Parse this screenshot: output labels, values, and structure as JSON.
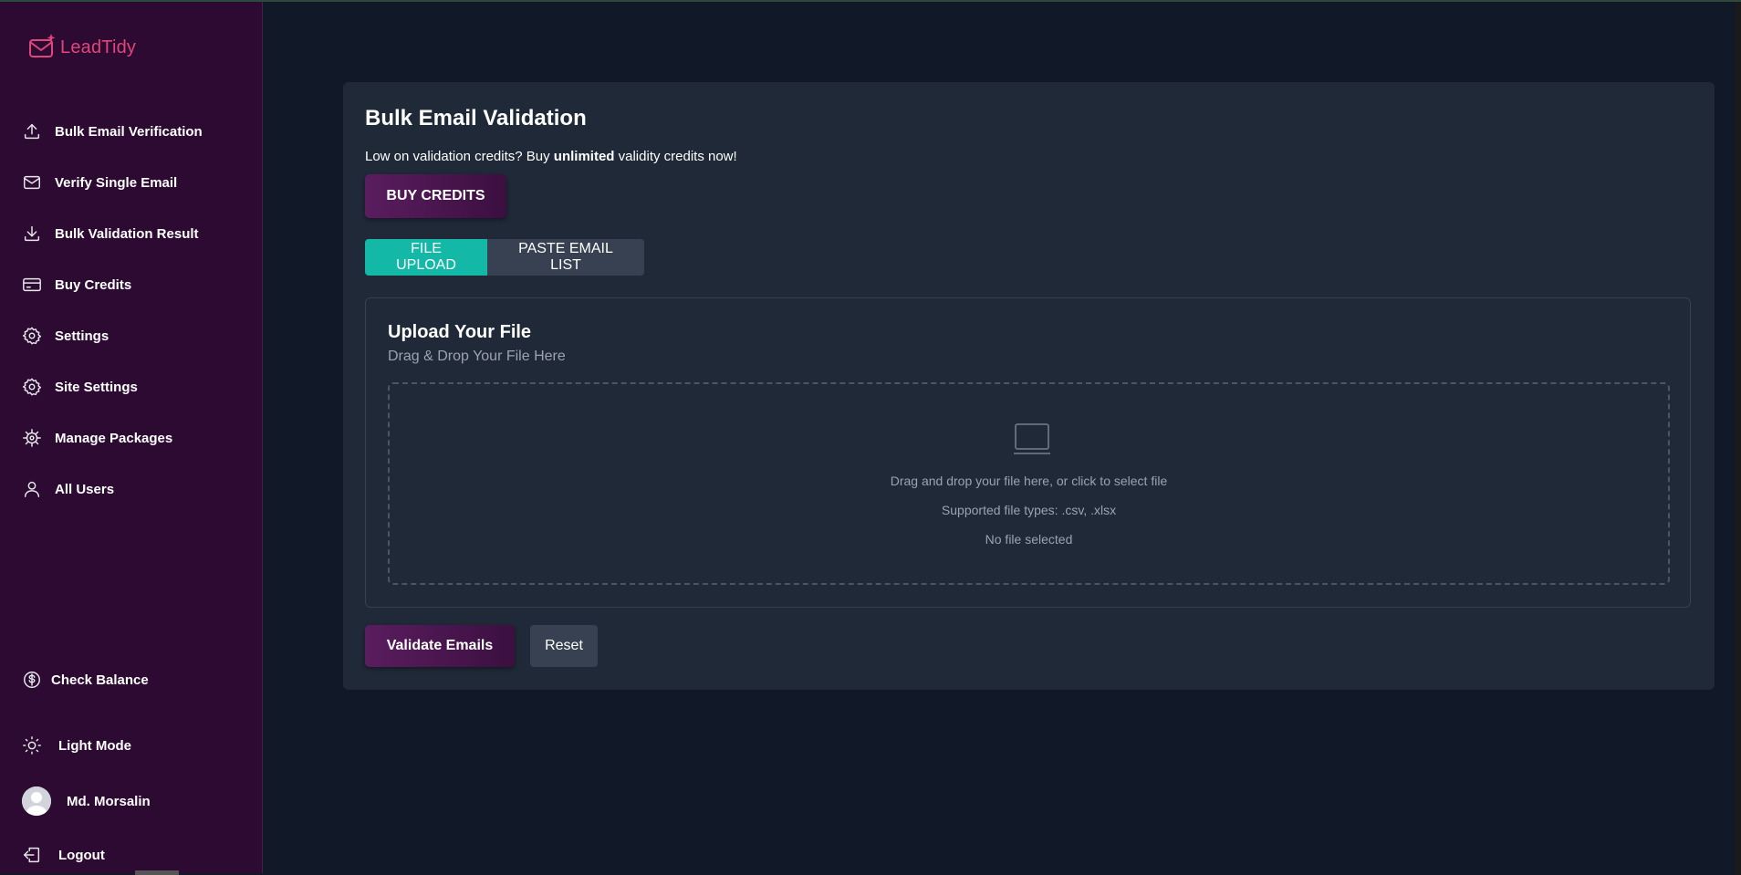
{
  "brand": {
    "name": "LeadTidy",
    "color": "#e0457b"
  },
  "sidebar": {
    "items": [
      {
        "label": "Bulk Email Verification",
        "icon": "upload-icon"
      },
      {
        "label": "Verify Single Email",
        "icon": "mail-icon"
      },
      {
        "label": "Bulk Validation Result",
        "icon": "download-icon"
      },
      {
        "label": "Buy Credits",
        "icon": "credit-card-icon"
      },
      {
        "label": "Settings",
        "icon": "gear-icon"
      },
      {
        "label": "Site Settings",
        "icon": "gear-icon"
      },
      {
        "label": "Manage Packages",
        "icon": "cog-icon"
      },
      {
        "label": "All Users",
        "icon": "user-icon"
      }
    ],
    "bottom": {
      "check_balance": "Check Balance",
      "light_mode": "Light Mode",
      "user_name": "Md. Morsalin",
      "logout": "Logout"
    }
  },
  "main": {
    "title": "Bulk Email Validation",
    "promo_prefix": "Low on validation credits? Buy ",
    "promo_bold": "unlimited",
    "promo_suffix": " validity credits now!",
    "buy_credits_label": "BUY CREDITS",
    "tabs": [
      {
        "label": "FILE UPLOAD",
        "active": true
      },
      {
        "label": "PASTE EMAIL LIST",
        "active": false
      }
    ],
    "upload": {
      "title": "Upload Your File",
      "subtitle": "Drag & Drop Your File Here",
      "drop_text": "Drag and drop your file here, or click to select file",
      "supported": "Supported file types: .csv, .xlsx",
      "status": "No file selected"
    },
    "validate_label": "Validate Emails",
    "reset_label": "Reset"
  },
  "colors": {
    "sidebar_bg": "#2c0a32",
    "page_bg": "#111827",
    "card_bg": "#1f2937",
    "accent_teal": "#14b8a6",
    "button_purple": "#5a1d5e"
  }
}
